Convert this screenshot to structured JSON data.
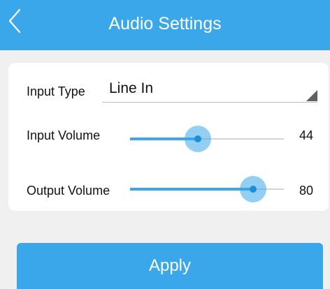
{
  "header": {
    "title": "Audio Settings",
    "back_icon": "chevron-left-icon"
  },
  "input_type": {
    "label": "Input Type",
    "value": "Line In",
    "arrow_icon": "dropdown-triangle-icon"
  },
  "input_volume": {
    "label": "Input Volume",
    "value": "44",
    "level": 44,
    "max": 100
  },
  "output_volume": {
    "label": "Output Volume",
    "value": "80",
    "level": 80,
    "max": 100
  },
  "apply_button": {
    "label": "Apply"
  },
  "colors": {
    "accent": "#3aa7ea",
    "background": "#f0f0f0",
    "card": "#ffffff"
  }
}
